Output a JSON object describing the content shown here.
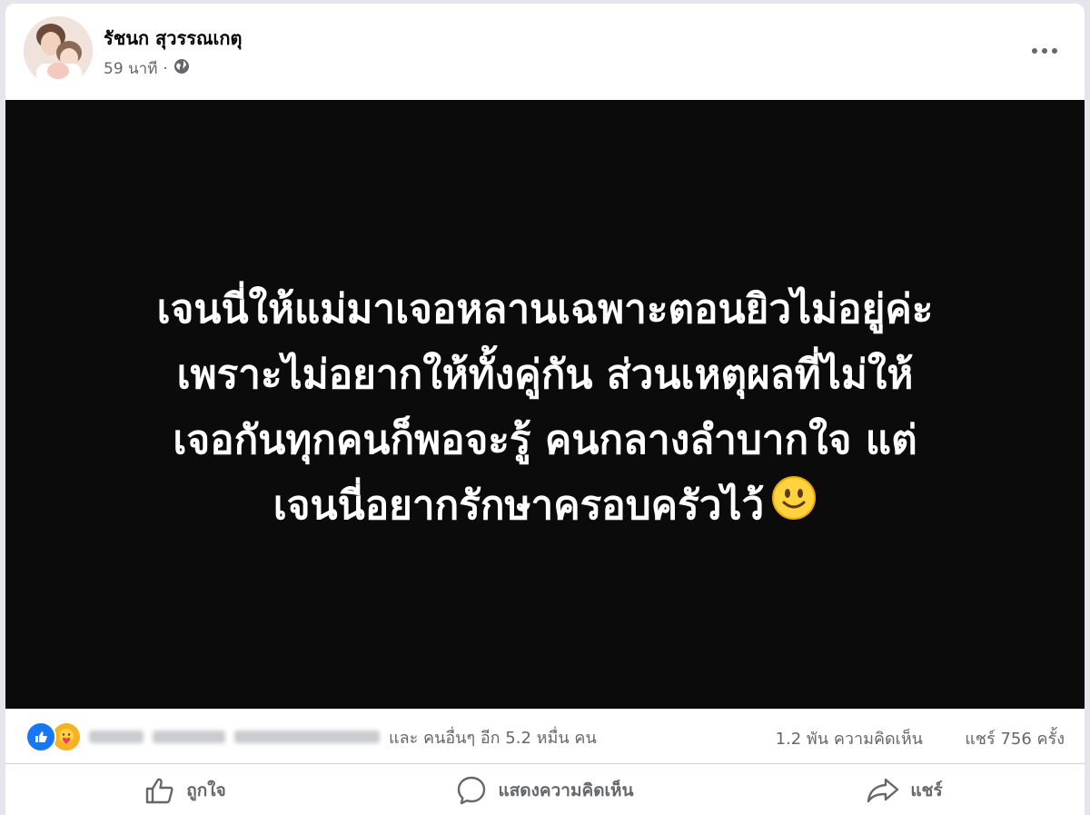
{
  "post": {
    "author": "รัชนก สุวรรณเกตุ",
    "time": "59 นาที",
    "separator": "·",
    "audience_icon": "globe-icon",
    "menu_icon": "more-horizontal-icon"
  },
  "image_text": {
    "lines": [
      "เจนนี่ให้แม่มาเจอหลานเฉพาะตอนยิวไม่อยู่ค่ะ",
      "เพราะไม่อยากให้ทั้งคู่กัน ส่วนเหตุผลที่ไม่ให้",
      "เจอกันทุกคนก็พอจะรู้ คนกลางลำบากใจ แต่",
      "เจนนี่อยากรักษาครอบครัวไว้"
    ],
    "emoji_icon": "smiling-face-icon",
    "background_color": "#0b0b0b",
    "text_color": "#ffffff"
  },
  "stats": {
    "reaction_icons": [
      "like-icon",
      "care-icon"
    ],
    "others_text": "และ คนอื่นๆ อีก 5.2 หมื่น คน",
    "comments_text": "1.2 พัน ความคิดเห็น",
    "shares_text": "แชร์ 756 ครั้ง"
  },
  "actions": {
    "like_label": "ถูกใจ",
    "comment_label": "แสดงความคิดเห็น",
    "share_label": "แชร์"
  },
  "colors": {
    "like_blue": "#1877f2",
    "care_yellow": "#f7b125",
    "secondary_text": "#65676b"
  }
}
